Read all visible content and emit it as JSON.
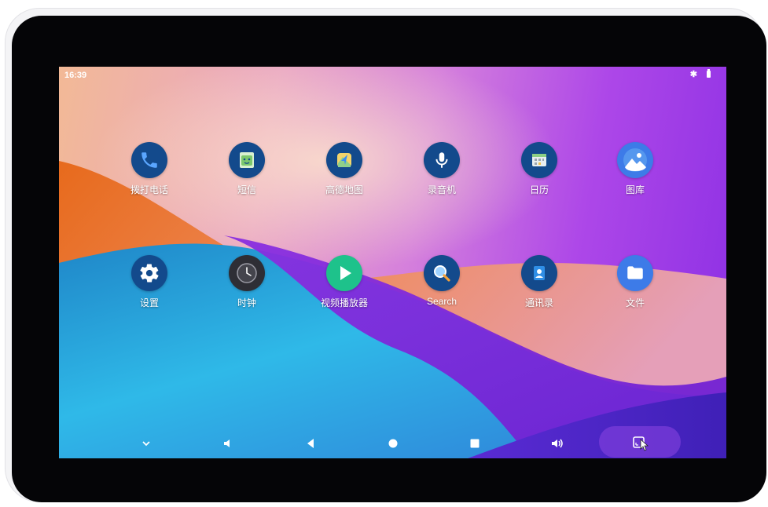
{
  "status_bar": {
    "time": "16:39"
  },
  "apps": [
    {
      "id": "dialer",
      "label": "拨打电话",
      "color": "#134a8c",
      "icon": "phone-icon"
    },
    {
      "id": "messages",
      "label": "短信",
      "color": "#134a8c",
      "icon": "messages-icon"
    },
    {
      "id": "amap",
      "label": "高德地图",
      "color": "#134a8c",
      "icon": "map-icon"
    },
    {
      "id": "recorder",
      "label": "录音机",
      "color": "#134a8c",
      "icon": "microphone-icon"
    },
    {
      "id": "calendar",
      "label": "日历",
      "color": "#134a8c",
      "icon": "calendar-icon"
    },
    {
      "id": "gallery",
      "label": "图库",
      "color": "#3d7be8",
      "icon": "gallery-icon"
    },
    {
      "id": "settings",
      "label": "设置",
      "color": "#134a8c",
      "icon": "gear-icon"
    },
    {
      "id": "clock",
      "label": "时钟",
      "color": "#2e2e35",
      "icon": "clock-icon"
    },
    {
      "id": "video",
      "label": "视频播放器",
      "color": "#1ec28b",
      "icon": "play-icon"
    },
    {
      "id": "search",
      "label": "Search",
      "color": "#134a8c",
      "icon": "search-icon"
    },
    {
      "id": "contacts",
      "label": "通讯录",
      "color": "#134a8c",
      "icon": "contacts-icon"
    },
    {
      "id": "files",
      "label": "文件",
      "color": "#3d7be8",
      "icon": "folder-icon"
    }
  ],
  "nav_bar": {
    "items": [
      "chevron-down-icon",
      "volume-down-icon",
      "back-icon",
      "home-icon",
      "recents-icon",
      "volume-up-icon",
      "screenshot-icon"
    ]
  }
}
